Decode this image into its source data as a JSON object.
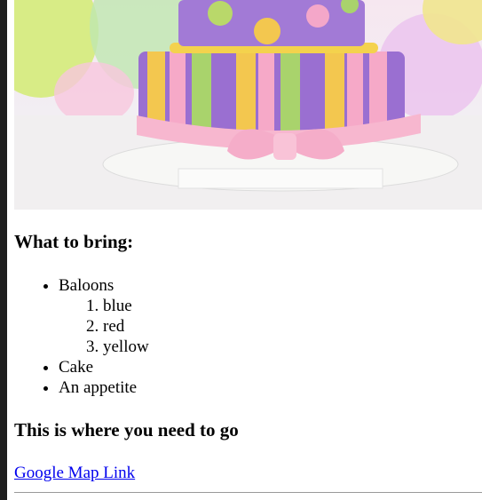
{
  "hero_image": {
    "alt": "Colorful birthday cake",
    "colors": {
      "balloon_green": "#cfe86a",
      "balloon_pink": "#f39ac8",
      "balloon_yellow": "#f6e27a",
      "cake_purple": "#9a6fd1",
      "cake_stripe_yellow": "#f3c74f",
      "cake_stripe_green": "#a9d36c",
      "cake_stripe_pink": "#f6a9c8",
      "bow_pink": "#f7b7cf",
      "plate": "#f6f6f4"
    }
  },
  "sections": {
    "bring_heading": "What to bring:",
    "items": [
      {
        "label": "Baloons",
        "sub_items": [
          "blue",
          "red",
          "yellow"
        ]
      },
      {
        "label": "Cake"
      },
      {
        "label": "An appetite"
      }
    ],
    "where_heading": "This is where you need to go",
    "map_link": "Google Map Link"
  }
}
